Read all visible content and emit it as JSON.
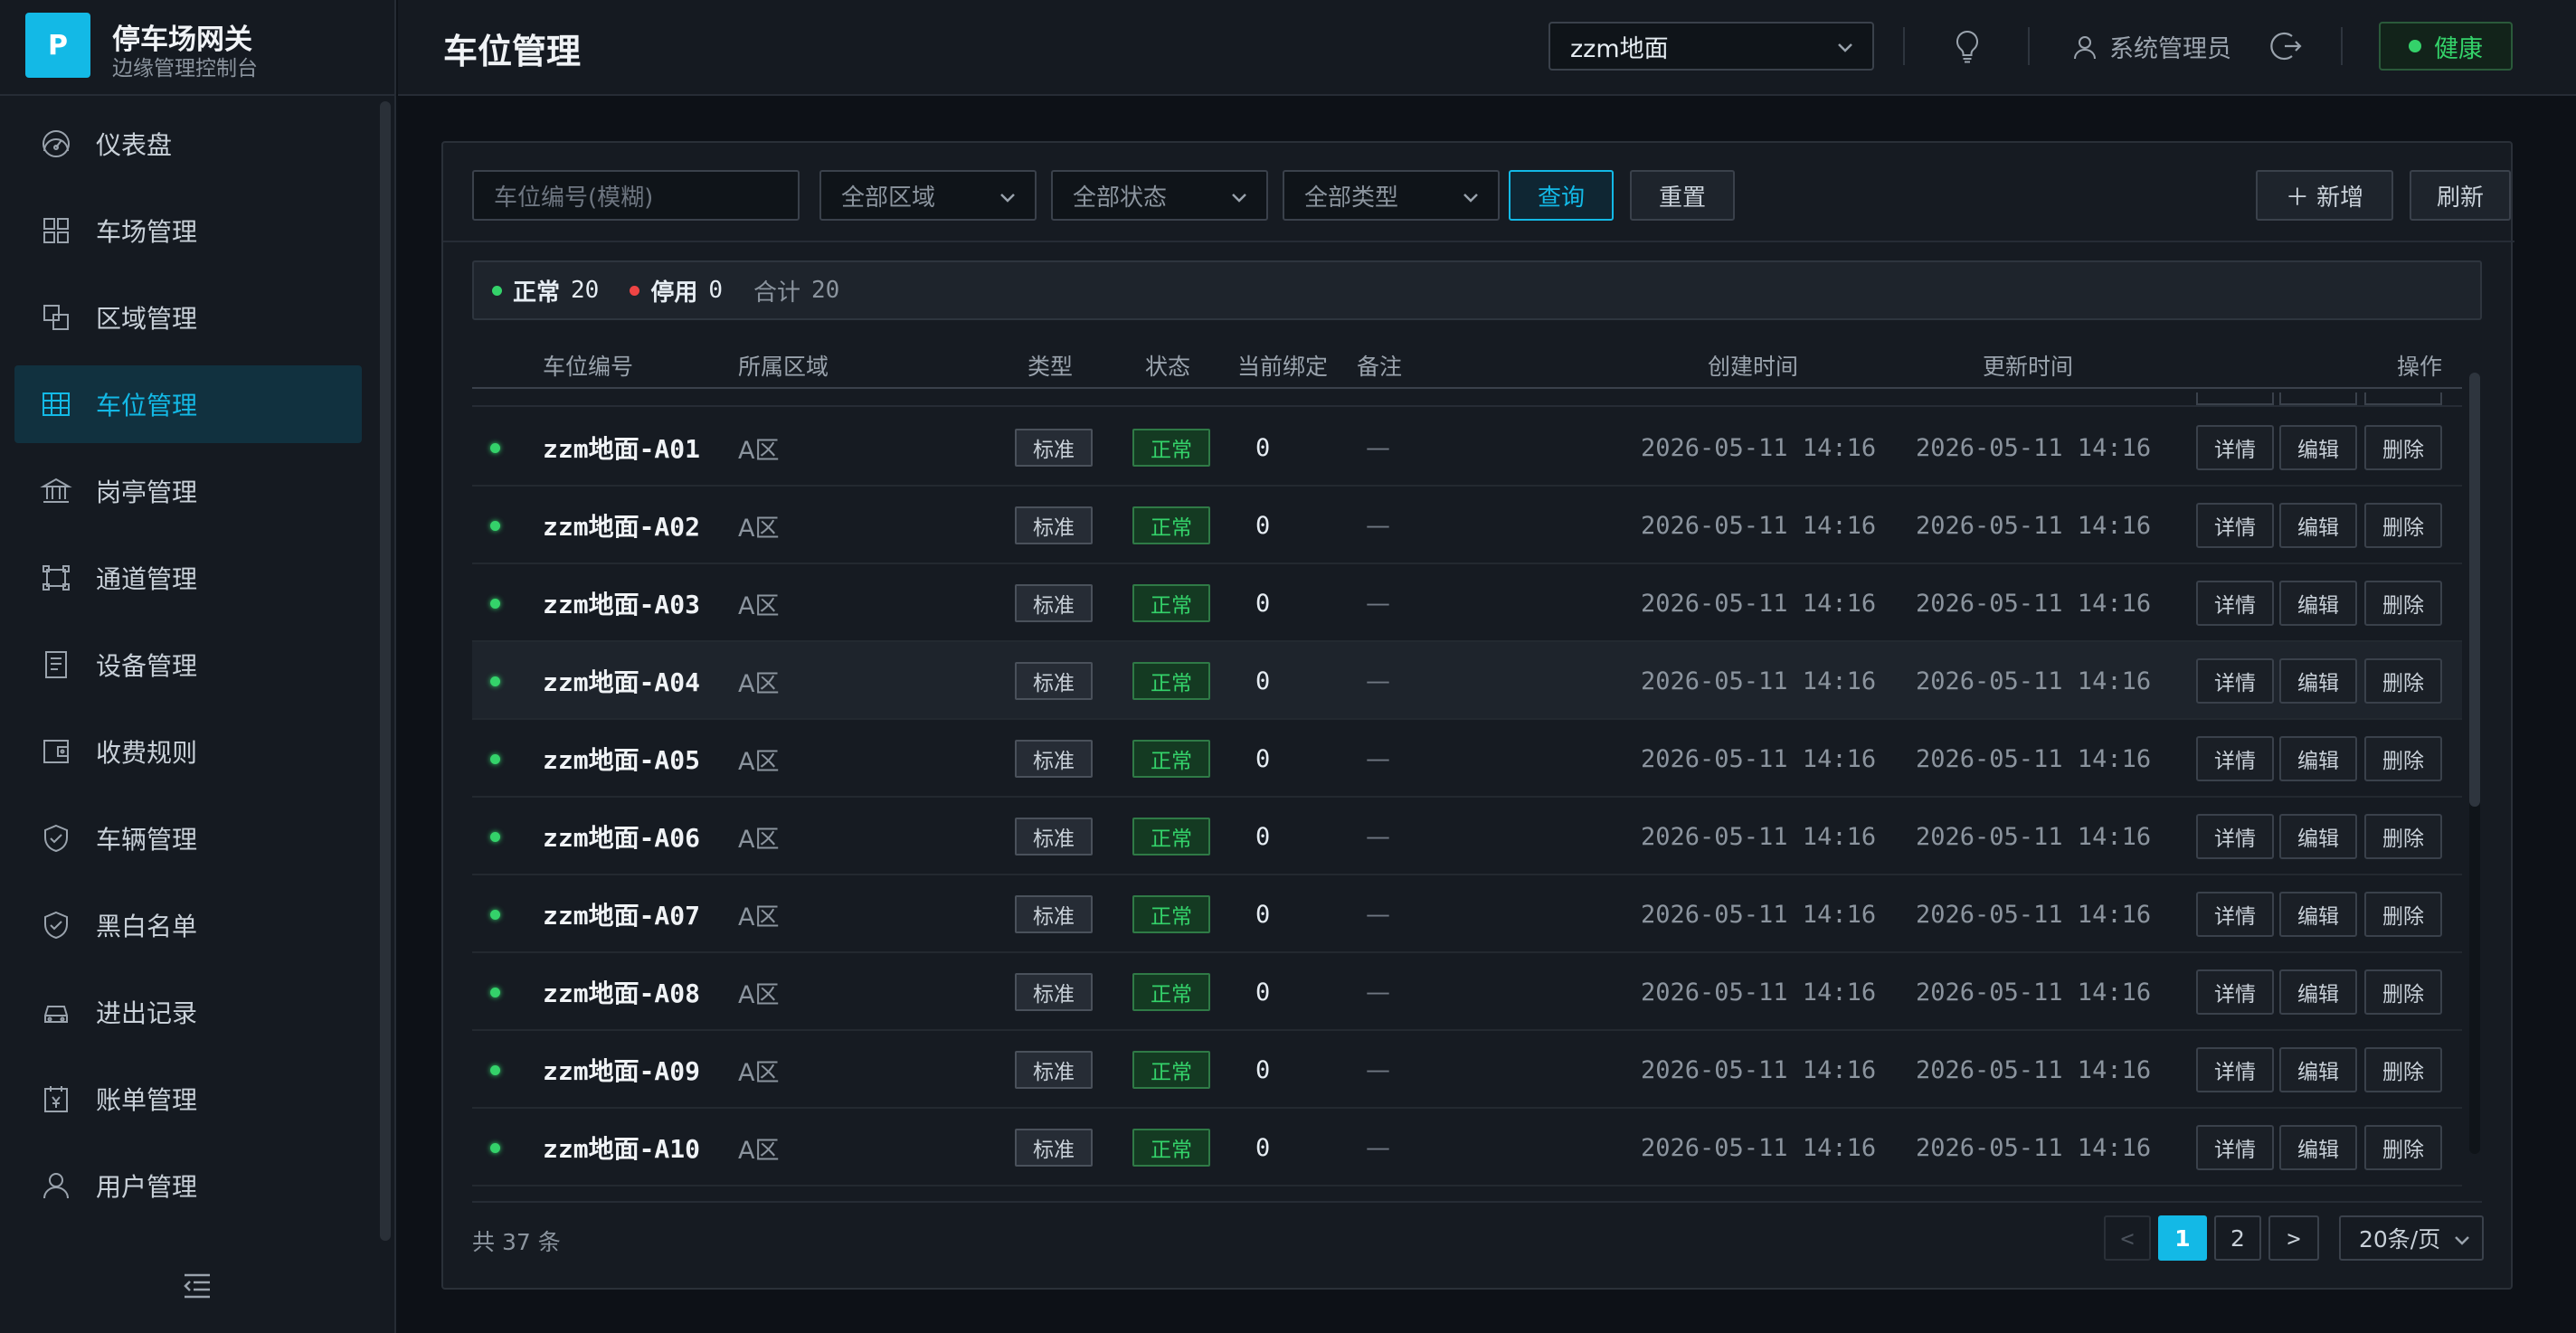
{
  "brand": {
    "logo": "P",
    "title": "停车场网关",
    "subtitle": "边缘管理控制台"
  },
  "sidebar": {
    "items": [
      {
        "label": "仪表盘",
        "icon": "dashboard-icon"
      },
      {
        "label": "车场管理",
        "icon": "grid-icon"
      },
      {
        "label": "区域管理",
        "icon": "layers-icon"
      },
      {
        "label": "车位管理",
        "icon": "table-icon",
        "active": true
      },
      {
        "label": "岗亭管理",
        "icon": "bank-icon"
      },
      {
        "label": "通道管理",
        "icon": "gate-icon"
      },
      {
        "label": "设备管理",
        "icon": "device-icon"
      },
      {
        "label": "收费规则",
        "icon": "wallet-icon"
      },
      {
        "label": "车辆管理",
        "icon": "shield-check-icon"
      },
      {
        "label": "黑白名单",
        "icon": "shield-check-icon"
      },
      {
        "label": "进出记录",
        "icon": "car-icon"
      },
      {
        "label": "账单管理",
        "icon": "bill-icon"
      },
      {
        "label": "用户管理",
        "icon": "user-icon"
      }
    ]
  },
  "header": {
    "title": "车位管理",
    "lot_selected": "zzm地面",
    "user": "系统管理员",
    "health": "健康"
  },
  "toolbar": {
    "search_placeholder": "车位编号(模糊)",
    "area_filter": "全部区域",
    "status_filter": "全部状态",
    "type_filter": "全部类型",
    "query_label": "查询",
    "reset_label": "重置",
    "add_label": "＋ 新增",
    "refresh_label": "刷新"
  },
  "summary": {
    "normal_label": "正常",
    "normal_count": "20",
    "disabled_label": "停用",
    "disabled_count": "0",
    "total_label": "合计",
    "total_count": "20"
  },
  "table": {
    "columns": [
      "车位编号",
      "所属区域",
      "类型",
      "状态",
      "当前绑定",
      "备注",
      "创建时间",
      "更新时间",
      "操作"
    ],
    "ops": {
      "detail": "详情",
      "edit": "编辑",
      "delete": "删除"
    },
    "rows": [
      {
        "code": "zzm地面-A01",
        "area": "A区",
        "type": "标准",
        "status": "正常",
        "bind": "0",
        "note": "—",
        "created": "2026-05-11 14:16",
        "updated": "2026-05-11 14:16"
      },
      {
        "code": "zzm地面-A02",
        "area": "A区",
        "type": "标准",
        "status": "正常",
        "bind": "0",
        "note": "—",
        "created": "2026-05-11 14:16",
        "updated": "2026-05-11 14:16"
      },
      {
        "code": "zzm地面-A03",
        "area": "A区",
        "type": "标准",
        "status": "正常",
        "bind": "0",
        "note": "—",
        "created": "2026-05-11 14:16",
        "updated": "2026-05-11 14:16"
      },
      {
        "code": "zzm地面-A04",
        "area": "A区",
        "type": "标准",
        "status": "正常",
        "bind": "0",
        "note": "—",
        "created": "2026-05-11 14:16",
        "updated": "2026-05-11 14:16"
      },
      {
        "code": "zzm地面-A05",
        "area": "A区",
        "type": "标准",
        "status": "正常",
        "bind": "0",
        "note": "—",
        "created": "2026-05-11 14:16",
        "updated": "2026-05-11 14:16"
      },
      {
        "code": "zzm地面-A06",
        "area": "A区",
        "type": "标准",
        "status": "正常",
        "bind": "0",
        "note": "—",
        "created": "2026-05-11 14:16",
        "updated": "2026-05-11 14:16"
      },
      {
        "code": "zzm地面-A07",
        "area": "A区",
        "type": "标准",
        "status": "正常",
        "bind": "0",
        "note": "—",
        "created": "2026-05-11 14:16",
        "updated": "2026-05-11 14:16"
      },
      {
        "code": "zzm地面-A08",
        "area": "A区",
        "type": "标准",
        "status": "正常",
        "bind": "0",
        "note": "—",
        "created": "2026-05-11 14:16",
        "updated": "2026-05-11 14:16"
      },
      {
        "code": "zzm地面-A09",
        "area": "A区",
        "type": "标准",
        "status": "正常",
        "bind": "0",
        "note": "—",
        "created": "2026-05-11 14:16",
        "updated": "2026-05-11 14:16"
      },
      {
        "code": "zzm地面-A10",
        "area": "A区",
        "type": "标准",
        "status": "正常",
        "bind": "0",
        "note": "—",
        "created": "2026-05-11 14:16",
        "updated": "2026-05-11 14:16"
      }
    ]
  },
  "pagination": {
    "total_text": "共 37 条",
    "prev": "<",
    "page1": "1",
    "page2": "2",
    "next": ">",
    "page_size": "20条/页"
  },
  "colors": {
    "accent": "#13b9e6",
    "success": "#34d26a",
    "danger": "#ef4444"
  }
}
